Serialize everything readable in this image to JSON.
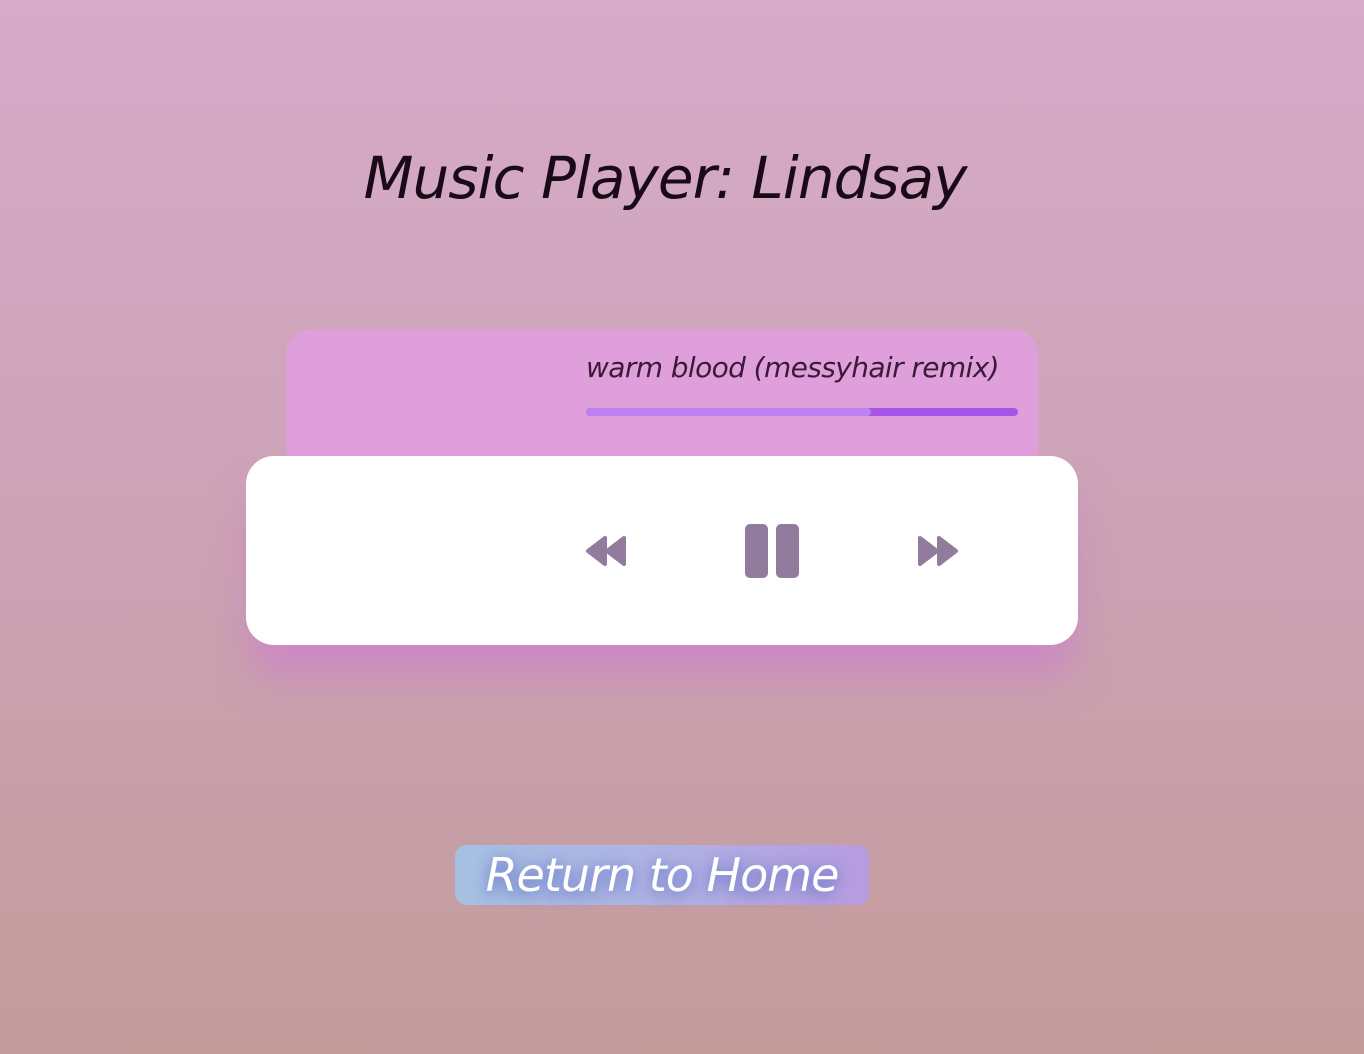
{
  "page": {
    "title": "Music Player: Lindsay"
  },
  "player": {
    "track_title": "warm blood (messyhair remix)",
    "progress": 0.66,
    "controls": {
      "previous_icon": "rewind-icon",
      "pause_icon": "pause-icon",
      "next_icon": "fast-forward-icon"
    }
  },
  "home_button": {
    "label": "Return to Home"
  },
  "colors": {
    "panel": "#de9fdb",
    "progress_played": "#bc82ef",
    "progress_remaining": "#a755e6",
    "icon": "#927c9e"
  }
}
